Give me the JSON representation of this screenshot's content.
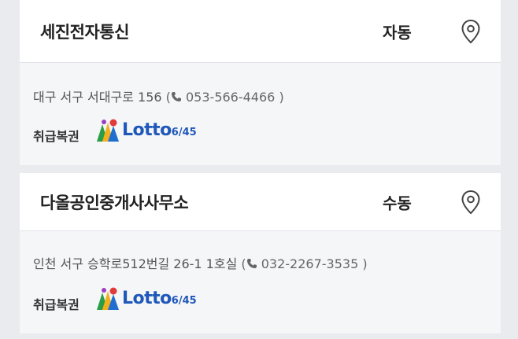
{
  "stores": [
    {
      "name": "세진전자통신",
      "mode": "자동",
      "address": "대구 서구 서대구로 156",
      "phone_open": "(",
      "phone": "053-566-4466",
      "phone_close": ")",
      "handles_label": "취급복권",
      "lotto_label": "Lotto",
      "lotto_sub": "6/45"
    },
    {
      "name": "다올공인중개사사무소",
      "mode": "수동",
      "address": "인천 서구 승학로512번길 26-1 1호실",
      "phone_open": "(",
      "phone": "032-2267-3535",
      "phone_close": ")",
      "handles_label": "취급복권",
      "lotto_label": "Lotto",
      "lotto_sub": "6/45"
    }
  ],
  "icons": {
    "pin": "map-pin-icon",
    "phone": "phone-icon",
    "lotto": "lotto-645-logo"
  },
  "colors": {
    "background": "#e9ebef",
    "card_header": "#ffffff",
    "card_body": "#f5f6f8",
    "lotto_blue": "#1f58b9"
  }
}
